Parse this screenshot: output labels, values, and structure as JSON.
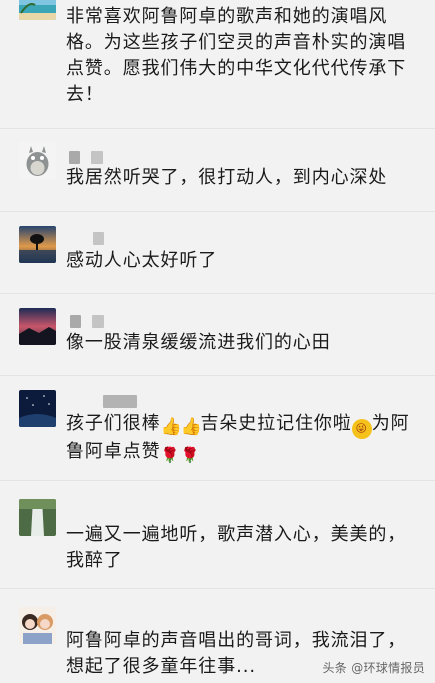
{
  "comments": [
    {
      "text": "非常喜欢阿鲁阿卓的歌声和她的演唱风格。为这些孩子们空灵的声音朴实的演唱点赞。愿我们伟大的中华文化代代传承下去！"
    },
    {
      "text": "我居然听哭了，很打动人，到内心深处"
    },
    {
      "text": "感动人心太好听了"
    },
    {
      "text": "像一股清泉缓缓流进我们的心田"
    },
    {
      "text_a": "孩子们很棒",
      "text_b": "吉朵史拉记住你啦",
      "text_c": "为阿鲁阿卓点赞"
    },
    {
      "text": "一遍又一遍地听，歌声潜入心，美美的，我醉了"
    },
    {
      "text": "阿鲁阿卓的声音唱出的哥词，我流泪了，想起了很多童年往事..."
    }
  ],
  "emojis": {
    "thumbs_up": "👍",
    "wink": "😜",
    "rose": "🌹"
  },
  "icons": {
    "avatar_1": "beach-landscape-avatar",
    "avatar_2": "totoro-avatar",
    "avatar_3": "tree-sunset-avatar",
    "avatar_4": "sunset-sky-avatar",
    "avatar_5": "night-sky-avatar",
    "avatar_6": "waterfall-avatar",
    "avatar_7": "anime-girls-avatar"
  },
  "watermark": "头条 @环球情报员"
}
